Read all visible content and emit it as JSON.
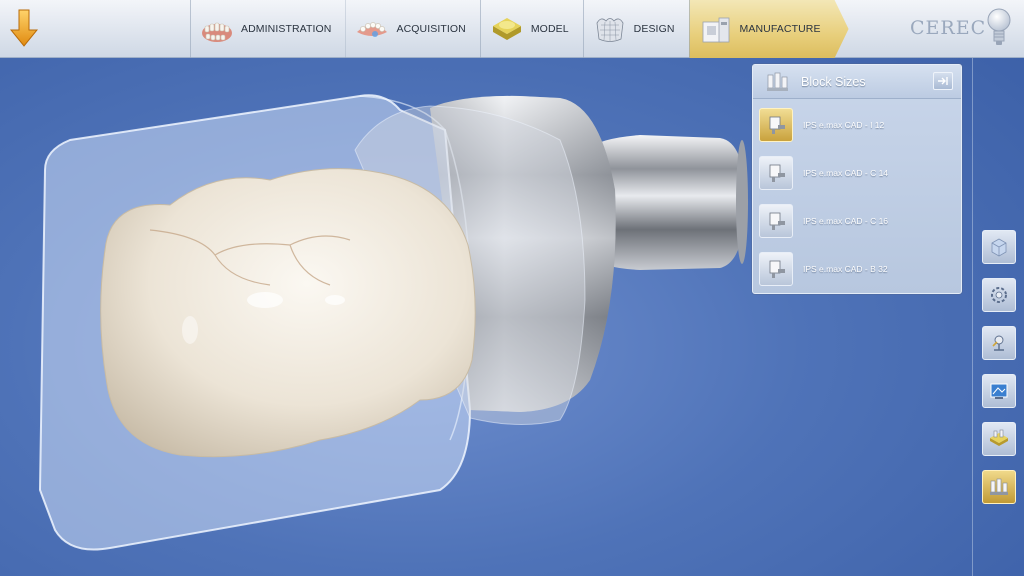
{
  "topbar": {
    "back_icon": "down-arrow-icon",
    "phases": [
      {
        "label": "ADMINISTRATION",
        "icon": "dentition-icon",
        "active": false
      },
      {
        "label": "ACQUISITION",
        "icon": "jaw-icon",
        "active": false
      },
      {
        "label": "MODEL",
        "icon": "model-icon",
        "active": false
      },
      {
        "label": "DESIGN",
        "icon": "crown-icon",
        "active": false
      },
      {
        "label": "MANUFACTURE",
        "icon": "milling-unit-icon",
        "active": true
      }
    ],
    "brand": "CEREC",
    "help_icon": "lightbulb-icon"
  },
  "panel": {
    "title": "Block Sizes",
    "items": [
      {
        "label": "IPS e.max CAD - I 12",
        "selected": true
      },
      {
        "label": "IPS e.max CAD - C 14",
        "selected": false
      },
      {
        "label": "IPS e.max CAD - C 16",
        "selected": false
      },
      {
        "label": "IPS e.max CAD - B 32",
        "selected": false
      }
    ]
  },
  "toolbar": {
    "tools": [
      "view-cube-icon",
      "rotation-icon",
      "sprue-icon",
      "preview-icon",
      "block-icon",
      "block-sizes-icon"
    ],
    "active_index": 5
  },
  "colors": {
    "background": "#4f73b8",
    "active_phase": "#e8cf7c",
    "panel": "#c9d6ea"
  }
}
